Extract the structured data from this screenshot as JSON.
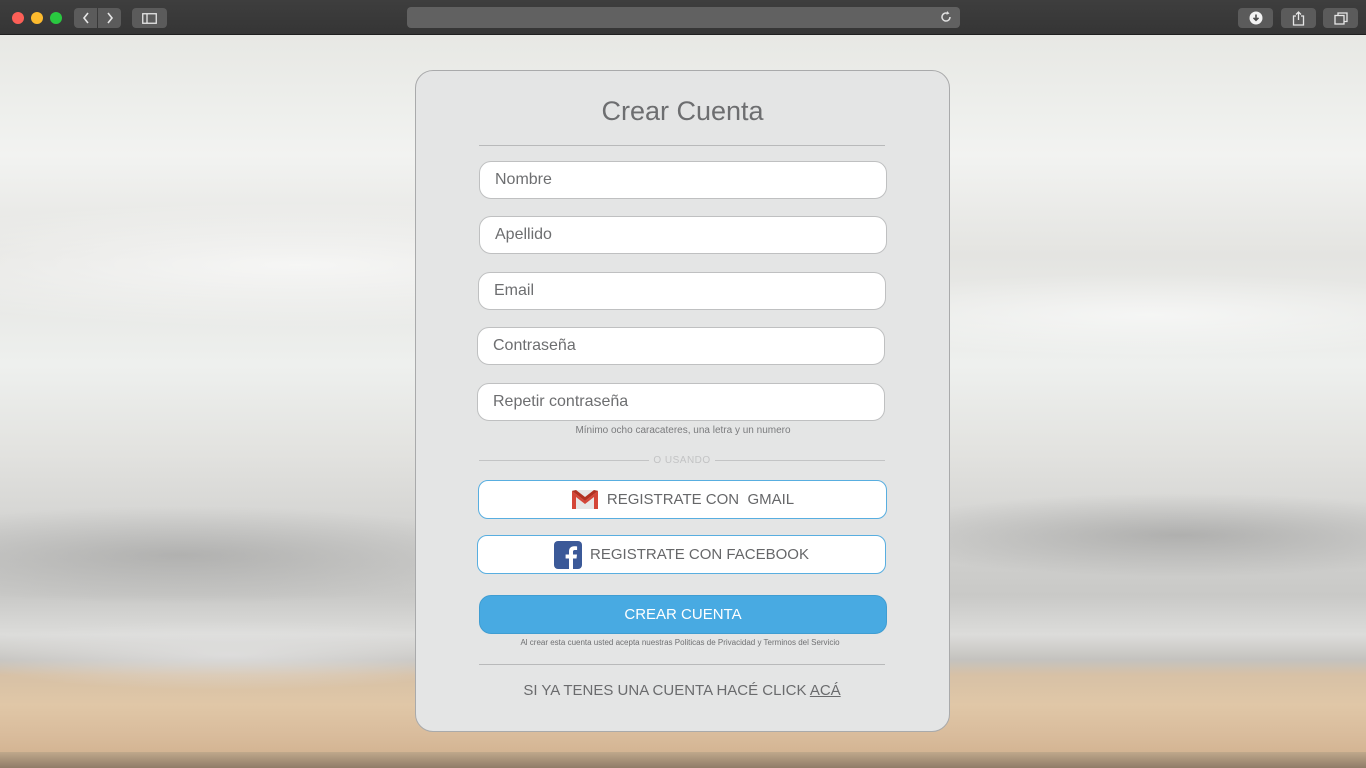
{
  "browser": {
    "traffic_lights": [
      "close",
      "minimize",
      "maximize"
    ],
    "icons": {
      "back": "chevron-left-icon",
      "forward": "chevron-right-icon",
      "sidebar": "sidebar-icon",
      "reload": "reload-icon",
      "download": "download-icon",
      "share": "share-icon",
      "tabs": "tabs-icon"
    },
    "address_text": ""
  },
  "form": {
    "title": "Crear Cuenta",
    "fields": [
      {
        "placeholder": "Nombre"
      },
      {
        "placeholder": "Apellido"
      },
      {
        "placeholder": "Email"
      },
      {
        "placeholder": "Contraseña"
      },
      {
        "placeholder": "Repetir contraseña"
      }
    ],
    "password_hint": "Mínimo ocho caracateres, una letra y un numero",
    "divider_text": "O USANDO",
    "gmail_button": "REGISTRATE CON  GMAIL",
    "facebook_button": "REGISTRATE CON FACEBOOK",
    "submit_button": "CREAR CUENTA",
    "legal_text": "Al crear esta cuenta usted acepta nuestras Politicas de Privacidad y Terminos del Servicio",
    "login_prompt": "SI YA TENES UNA CUENTA HACÉ CLICK ",
    "login_link": "ACÁ"
  },
  "colors": {
    "primary": "#48aae2",
    "card_bg": "#e4e5e5",
    "social_border": "#58aee0",
    "gmail_red": "#d44638",
    "facebook_blue": "#3b5998"
  }
}
